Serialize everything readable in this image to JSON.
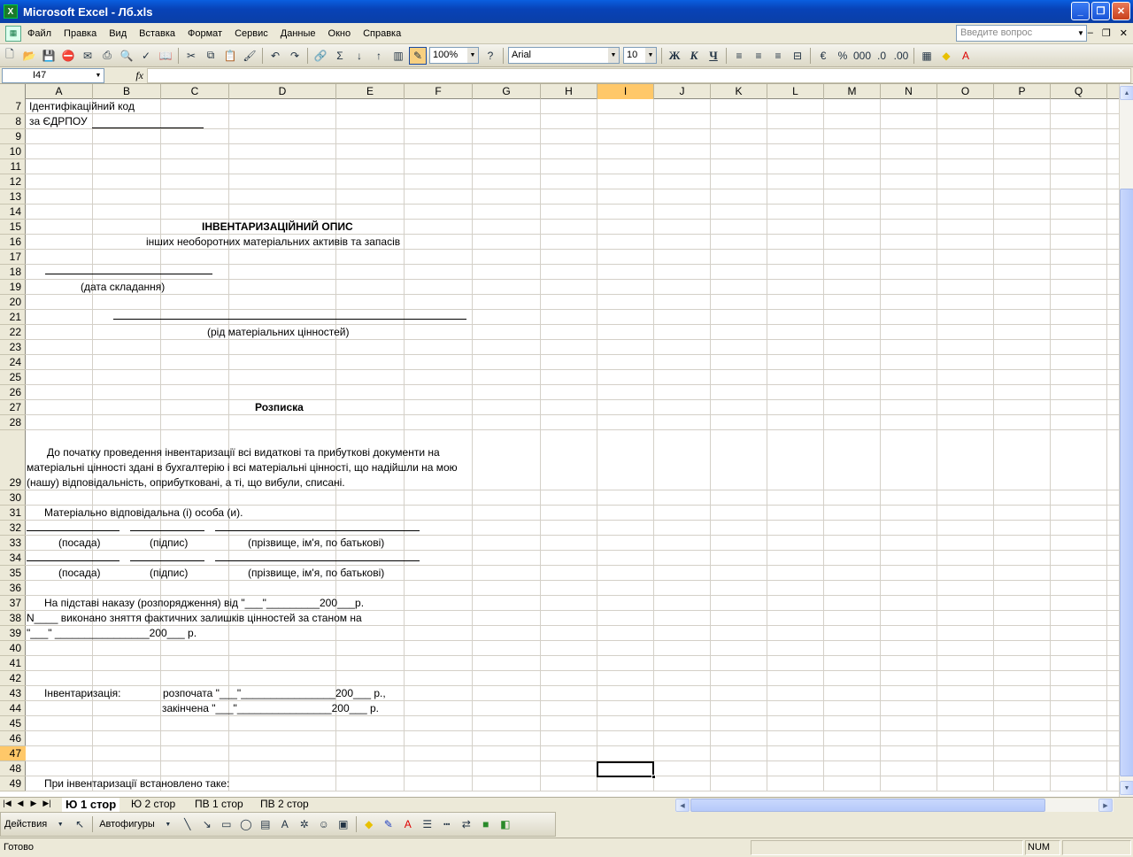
{
  "window": {
    "title": "Microsoft Excel - Лб.xls"
  },
  "menu": {
    "items": [
      "Файл",
      "Правка",
      "Вид",
      "Вставка",
      "Формат",
      "Сервис",
      "Данные",
      "Окно",
      "Справка"
    ],
    "help_placeholder": "Введите вопрос"
  },
  "toolbar": {
    "zoom": "100%",
    "font": "Arial",
    "font_size": "10",
    "bold": "Ж",
    "italic": "К",
    "underline": "Ч"
  },
  "formula_bar": {
    "name_box": "I47",
    "fx": "fx",
    "formula": ""
  },
  "columns": [
    "A",
    "B",
    "C",
    "D",
    "E",
    "F",
    "G",
    "H",
    "I",
    "J",
    "K",
    "L",
    "M",
    "N",
    "O",
    "P",
    "Q"
  ],
  "rows": [
    "7",
    "8",
    "9",
    "10",
    "11",
    "12",
    "13",
    "14",
    "15",
    "16",
    "17",
    "18",
    "19",
    "20",
    "21",
    "22",
    "23",
    "24",
    "25",
    "26",
    "27",
    "28",
    "29",
    "30",
    "31",
    "32",
    "33",
    "34",
    "35",
    "36",
    "37",
    "38",
    "39",
    "40",
    "41",
    "42",
    "43",
    "44",
    "45",
    "46",
    "47",
    "48",
    "49"
  ],
  "selected_cell": {
    "column": "I",
    "row": "47"
  },
  "cells": {
    "r7": "Ідентифікаційний код",
    "r8": "за ЄДРПОУ",
    "title": "ІНВЕНТАРИЗАЦІЙНИЙ ОПИС",
    "subtitle": "інших необоротних матеріальних активів та запасів",
    "date_caption": "(дата складання)",
    "kind_caption": "(рід матеріальних цінностей)",
    "receipt": "Розписка",
    "para_line1": "До   початку   проведення   інвентаризації    всі    видаткові    та прибуткові документи на",
    "para_line2": "матеріальні цінності здані в бухгалтерію і всі   матеріальні   цінності,   що   надійшли   на   мою",
    "para_line3": "(нашу) відповідальність, оприбутковані, а ті, що вибули, списані.",
    "responsible": "Матеріально відповідальна (і) особа (и).",
    "position": "(посада)",
    "signature": "(підпис)",
    "full_name": "(прізвище, ім'я, по батькові)",
    "order_line": "На підставі наказу (розпорядження) від \"___\"_________200___р.",
    "order_n": "N____  виконано  зняття  фактичних  залишків цінностей за станом на",
    "order_date": "\"___\" ________________200___ р.",
    "inventory": "Інвентаризація:",
    "started": "розпочата \"___\"________________200___ р.,",
    "finished": "закінчена \"___\"________________200___ р.",
    "established": "При інвентаризації встановлено таке:"
  },
  "sheets": [
    {
      "name": "Ю 1 стор",
      "active": true
    },
    {
      "name": "Ю 2 стор",
      "active": false
    },
    {
      "name": "ПВ 1 стор",
      "active": false
    },
    {
      "name": "ПВ 2 стор",
      "active": false
    }
  ],
  "drawing_toolbar": {
    "actions": "Действия",
    "autoshapes": "Автофигуры"
  },
  "status": {
    "ready": "Готово",
    "num": "NUM"
  }
}
